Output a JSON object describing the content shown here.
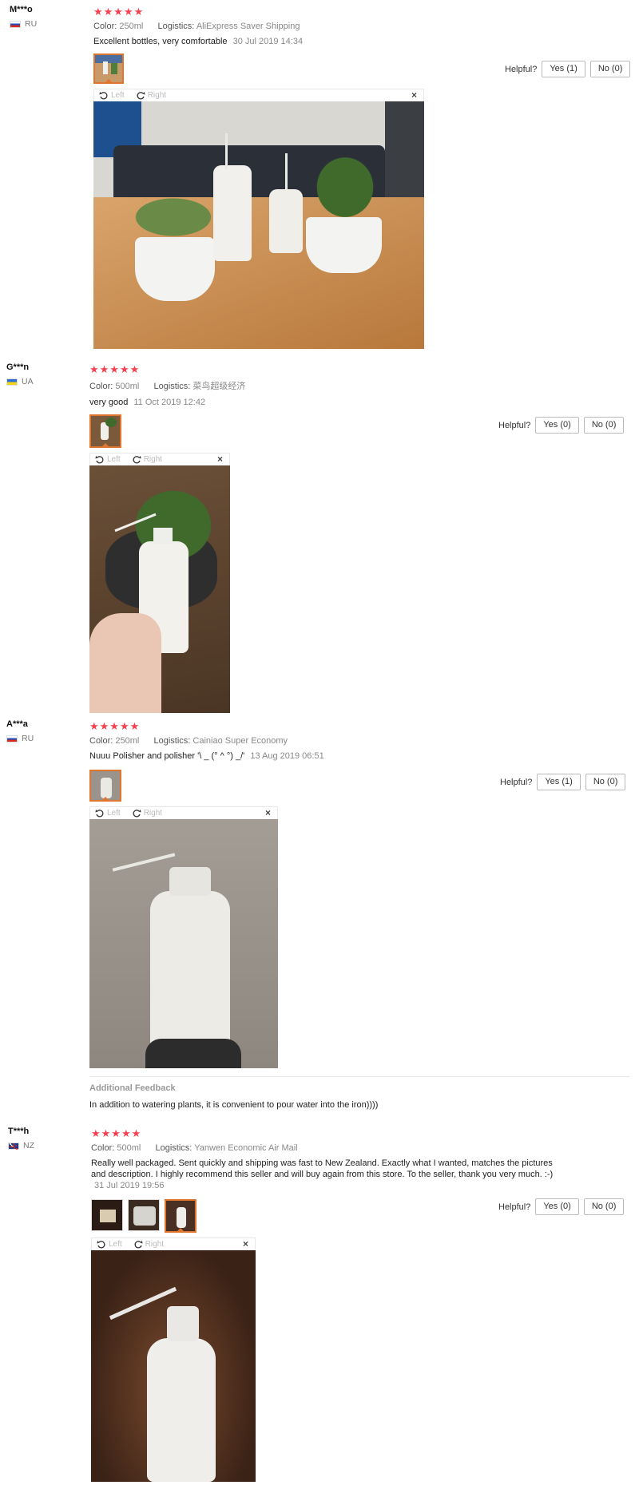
{
  "helpful_label": "Helpful?",
  "viewer": {
    "left_label": "Left",
    "right_label": "Right",
    "close_glyph": "×"
  },
  "star_glyphs": "★★★★★",
  "color_label": "Color:",
  "logistics_label": "Logistics:",
  "reviews": [
    {
      "user": "M***o",
      "country": "RU",
      "rating": 5,
      "color": "250ml",
      "logistics": "AliExpress Saver Shipping",
      "text": "Excellent bottles, very comfortable",
      "date": "30 Jul 2019 14:34",
      "yes": "Yes (1)",
      "no": "No (0)"
    },
    {
      "user": "G***n",
      "country": "UA",
      "rating": 5,
      "color": "500ml",
      "logistics": "菜鸟超级经济",
      "text": "very good",
      "date": "11 Oct 2019 12:42",
      "yes": "Yes (0)",
      "no": "No (0)"
    },
    {
      "user": "A***a",
      "country": "RU",
      "rating": 5,
      "color": "250ml",
      "logistics": "Cainiao Super Economy",
      "text": "Nuuu Polisher and polisher '\\ _ (° ^ °) _/'",
      "date": "13 Aug 2019 06:51",
      "yes": "Yes (1)",
      "no": "No (0)",
      "additional_feedback_title": "Additional Feedback",
      "additional_feedback": "In addition to watering plants, it is convenient to pour water into the iron))))"
    },
    {
      "user": "T***h",
      "country": "NZ",
      "rating": 5,
      "color": "500ml",
      "logistics": "Yanwen Economic Air Mail",
      "text": "Really well packaged. Sent quickly and shipping was fast to New Zealand. Exactly what I wanted, matches the pictures and description. I highly recommend this seller and will buy again from this store. To the seller, thank you very much. :-)",
      "date": "31 Jul 2019 19:56",
      "yes": "Yes (0)",
      "no": "No (0)"
    }
  ],
  "colors": {
    "star": "#f5414f",
    "thumb_selected": "#e0752e"
  }
}
